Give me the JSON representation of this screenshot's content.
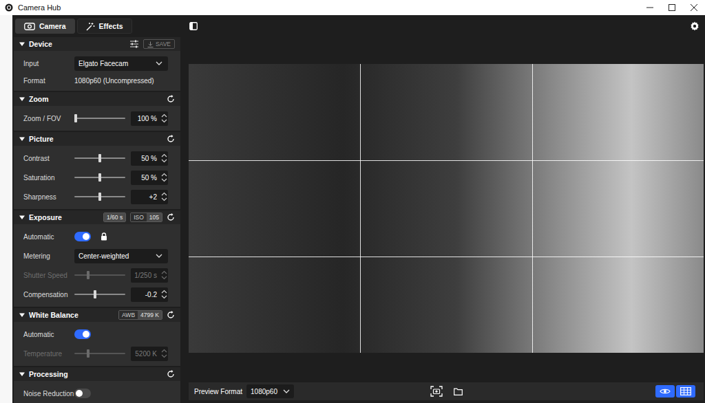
{
  "window": {
    "title": "Camera Hub"
  },
  "tabs": [
    {
      "label": "Camera",
      "selected": true
    },
    {
      "label": "Effects",
      "selected": false
    }
  ],
  "sections": [
    {
      "title": "Device",
      "expanded": true,
      "save": {
        "label": "SAVE",
        "disabled": true
      },
      "badges": [],
      "rows": [
        {
          "kind": "select",
          "label": "Input",
          "value": "Elgato Facecam",
          "disabled": false
        },
        {
          "kind": "text",
          "label": "Format",
          "value": "1080p60 (Uncompressed)",
          "disabled": false
        }
      ]
    },
    {
      "title": "Zoom",
      "expanded": true,
      "badges": [],
      "rows": [
        {
          "kind": "slider",
          "label": "Zoom / FOV",
          "value": "100 %",
          "level": 0,
          "disabled": false
        }
      ]
    },
    {
      "title": "Picture",
      "expanded": true,
      "badges": [],
      "rows": [
        {
          "kind": "slider",
          "label": "Contrast",
          "value": "50 %",
          "level": 0.5,
          "disabled": false
        },
        {
          "kind": "slider",
          "label": "Saturation",
          "value": "50 %",
          "level": 0.5,
          "disabled": false
        },
        {
          "kind": "slider",
          "label": "Sharpness",
          "value": "+2",
          "level": 0.5,
          "disabled": false
        }
      ]
    },
    {
      "title": "Exposure",
      "expanded": true,
      "badges": [
        {
          "parts": [
            "1/60 s"
          ]
        },
        {
          "parts": [
            "ISO",
            "105"
          ]
        }
      ],
      "rows": [
        {
          "kind": "toggle",
          "label": "Automatic",
          "on": true,
          "lock": true,
          "disabled": false
        },
        {
          "kind": "select",
          "label": "Metering",
          "value": "Center-weighted",
          "disabled": false
        },
        {
          "kind": "slider",
          "label": "Shutter Speed",
          "value": "1/250 s",
          "level": 0.25,
          "disabled": true
        },
        {
          "kind": "slider",
          "label": "Compensation",
          "value": "-0.2",
          "level": 0.4,
          "disabled": false
        }
      ]
    },
    {
      "title": "White Balance",
      "expanded": true,
      "badges": [
        {
          "parts": [
            "AWB",
            "4799 K"
          ]
        }
      ],
      "rows": [
        {
          "kind": "toggle",
          "label": "Automatic",
          "on": true,
          "lock": false,
          "disabled": false
        },
        {
          "kind": "slider",
          "label": "Temperature",
          "value": "5200 K",
          "level": 0.25,
          "disabled": true
        }
      ]
    },
    {
      "title": "Processing",
      "expanded": true,
      "badges": [],
      "rows": [
        {
          "kind": "toggle",
          "label": "Noise Reduction",
          "on": false,
          "lock": false,
          "disabled": false
        }
      ]
    }
  ],
  "preview": {
    "format_label": "Preview Format",
    "format": "1080p60",
    "visible": true,
    "grid": true
  }
}
